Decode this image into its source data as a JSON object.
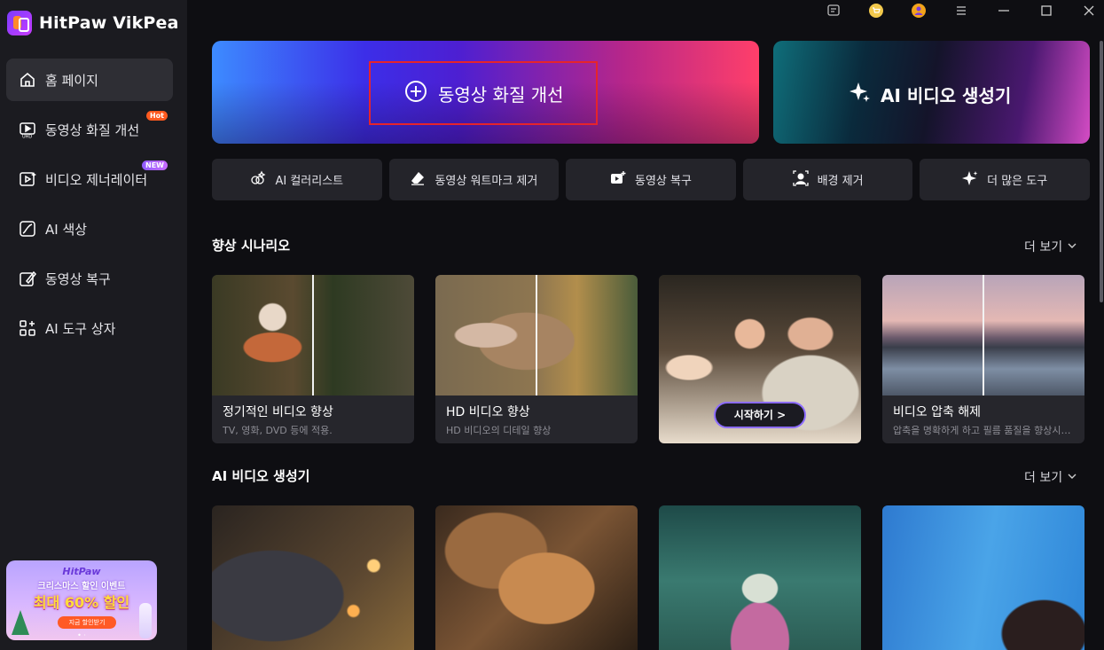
{
  "app": {
    "name": "HitPaw VikPea"
  },
  "sidebar": {
    "items": [
      {
        "label": "홈 페이지",
        "icon": "home-icon",
        "active": true
      },
      {
        "label": "동영상 화질 개선",
        "icon": "uhd-video-icon",
        "badge": "Hot"
      },
      {
        "label": "비디오 제너레이터",
        "icon": "video-play-icon",
        "badge": "NEW"
      },
      {
        "label": "AI 색상",
        "icon": "color-curve-icon"
      },
      {
        "label": "동영상 복구",
        "icon": "repair-icon"
      },
      {
        "label": "AI 도구 상자",
        "icon": "toolbox-icon"
      }
    ]
  },
  "promo": {
    "brand": "HitPaw",
    "line1": "크리스마스 할인 이벤트",
    "line2": "최대 60% 할인",
    "button": "지금 할인받기"
  },
  "titlebar": {
    "icons": [
      "feedback-icon",
      "cart-icon",
      "account-icon",
      "menu-icon",
      "minimize-icon",
      "maximize-icon",
      "close-icon"
    ]
  },
  "hero": {
    "main_label": "동영상 화질 개선",
    "ai_label": "AI 비디오 생성기"
  },
  "tools": [
    {
      "label": "AI 컬러리스트",
      "icon": "colorist-icon"
    },
    {
      "label": "동영상 워트마크 제거",
      "icon": "eraser-icon"
    },
    {
      "label": "동영상 복구",
      "icon": "video-repair-icon"
    },
    {
      "label": "배경 제거",
      "icon": "background-remove-icon"
    },
    {
      "label": "더 많은 도구",
      "icon": "sparkle-icon"
    }
  ],
  "sections": {
    "enhance": {
      "title": "향상 시나리오",
      "more": "더 보기",
      "cards": [
        {
          "title": "정기적인 비디오 향상",
          "sub": "TV, 영화, DVD 등에 적용."
        },
        {
          "title": "HD 비디오 향상",
          "sub": "HD 비디오의 디테일 향상"
        },
        {
          "button": "시작하기 >"
        },
        {
          "title": "비디오 압축 해제",
          "sub": "압축을 명확하게 하고 필름 품질을 향상시킵니다"
        }
      ]
    },
    "ai_video": {
      "title": "AI 비디오 생성기",
      "more": "더 보기"
    }
  },
  "colors": {
    "sidebar_bg": "#1b1b20",
    "content_bg": "#0e0e12",
    "focus_outline": "#e6242b",
    "hot_badge": "#ff5a1f"
  }
}
